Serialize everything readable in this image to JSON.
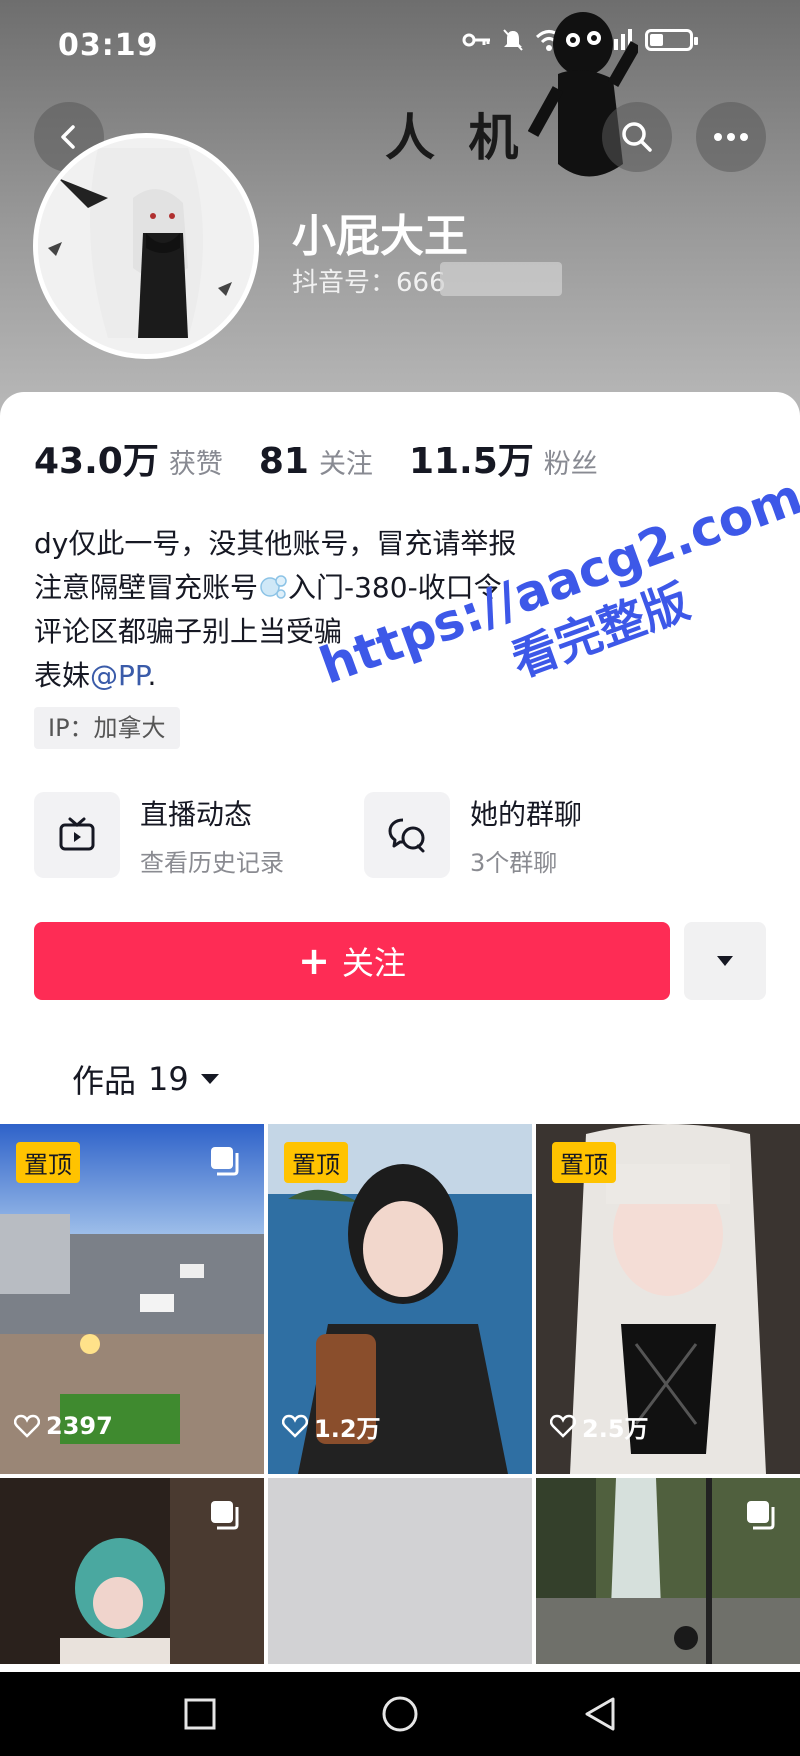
{
  "status_bar": {
    "time": "03:19",
    "network": "5G",
    "battery_level": 0.35
  },
  "header": {
    "sticker_text": "人 机",
    "nickname": "小屁大王",
    "douyin_id": "抖音号：666"
  },
  "stats": [
    {
      "value": "43.0万",
      "label": "获赞"
    },
    {
      "value": "81",
      "label": "关注"
    },
    {
      "value": "11.5万",
      "label": "粉丝"
    }
  ],
  "bio": {
    "line1": "dy仅此一号，没其他账号，冒充请举报",
    "line2_a": "注意隔壁冒充账号",
    "line2_b": "入门-380-收口令",
    "line3": "评论区都骗子别上当受骗",
    "line4_prefix": "表妹",
    "line4_mention": "@PP",
    "line4_suffix": "."
  },
  "ip_tag": "IP：加拿大",
  "entries": [
    {
      "title": "直播动态",
      "subtitle": "查看历史记录",
      "icon": "tv-icon"
    },
    {
      "title": "她的群聊",
      "subtitle": "3个群聊",
      "icon": "chat-bubbles-icon"
    }
  ],
  "follow_button": {
    "plus": "+",
    "label": "关注"
  },
  "works_tab": {
    "label": "作品",
    "count": "19"
  },
  "tiles": [
    {
      "pinned": true,
      "badge": "置顶",
      "multi": true,
      "likes": "2397",
      "scene": "airport"
    },
    {
      "pinned": true,
      "badge": "置顶",
      "multi": false,
      "likes": "1.2万",
      "scene": "sea-portrait"
    },
    {
      "pinned": true,
      "badge": "置顶",
      "multi": false,
      "likes": "2.5万",
      "scene": "white-hair-portrait"
    },
    {
      "pinned": false,
      "multi": true,
      "scene": "teal-hair"
    },
    {
      "pinned": false,
      "multi": false,
      "scene": "blank"
    },
    {
      "pinned": false,
      "multi": true,
      "scene": "waterfall"
    }
  ],
  "watermark": {
    "url": "https://aacg2.com",
    "text": "看完整版"
  },
  "colors": {
    "accent": "#fe2c55",
    "badge": "#ffc300",
    "watermark": "#3d58e8",
    "mention": "#3a5ba9"
  }
}
